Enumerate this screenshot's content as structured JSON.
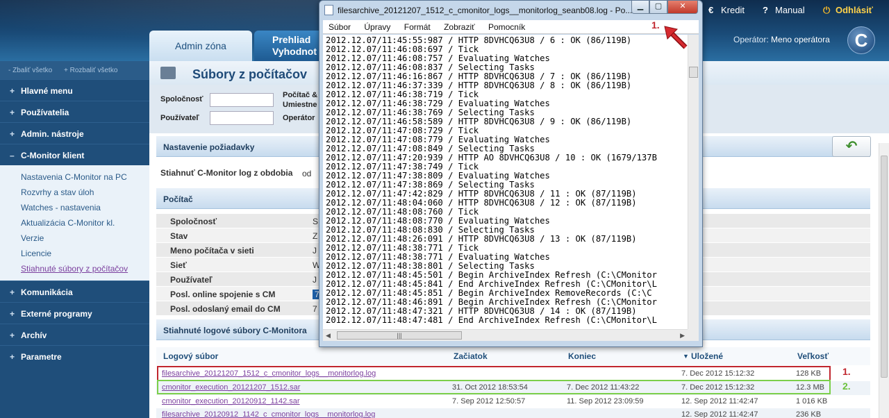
{
  "header": {
    "tabs": [
      {
        "label": "Admin zóna"
      },
      {
        "line1": "Prehliad",
        "line2": "Vyhodnot"
      }
    ],
    "menu": {
      "kredit": "Kredit",
      "manual": "Manual",
      "odhlasit": "Odhlásiť"
    },
    "operator_label": "Operátor:",
    "operator_name": "Meno operátora",
    "logo_letter": "C"
  },
  "sidebar": {
    "collapse_all": "- Zbaliť všetko",
    "expand_all": "+ Rozbaliť všetko",
    "items": [
      {
        "sign": "+",
        "label": "Hlavné menu"
      },
      {
        "sign": "+",
        "label": "Používatelia"
      },
      {
        "sign": "+",
        "label": "Admin. nástroje"
      },
      {
        "sign": "–",
        "label": "C-Monitor klient"
      }
    ],
    "subitems": [
      "Nastavenia C-Monitor na PC",
      "Rozvrhy a stav úloh",
      "Watches - nastavenia",
      "Aktualizácia C-Monitor kl.",
      "Verzie",
      "Licencie",
      "Stiahnuté súbory z počítačov"
    ],
    "items_after": [
      {
        "sign": "+",
        "label": "Komunikácia"
      },
      {
        "sign": "+",
        "label": "Externé programy"
      },
      {
        "sign": "+",
        "label": "Archív"
      },
      {
        "sign": "+",
        "label": "Parametre"
      }
    ]
  },
  "main": {
    "title": "Súbory z počítačov",
    "filters": {
      "company_label": "Spoločnosť",
      "user_label": "Používateľ",
      "computer_label": "Počítač &",
      "location_label": "Umiestne",
      "operator_label": "Operátor"
    },
    "request_section": "Nastavenie požiadavky",
    "download_label": "Stiahnuť C-Monitor log z obdobia",
    "download_from": "od",
    "computer_section": "Počítač",
    "computer_rows": [
      {
        "label": "Spoločnosť",
        "value": "S"
      },
      {
        "label": "Stav",
        "value": "Z"
      },
      {
        "label": "Meno počítača v sieti",
        "value": "J"
      },
      {
        "label": "Sieť",
        "value": "W"
      },
      {
        "label": "Používateľ",
        "value": "J"
      },
      {
        "label": "Posl. online spojenie s CM",
        "value": "7"
      },
      {
        "label": "Posl. odoslaný email do CM",
        "value": "7"
      }
    ],
    "logs_section": "Stiahnuté logové súbory C-Monitora",
    "table": {
      "headers": {
        "file": "Logový súbor",
        "start": "Začiatok",
        "end": "Koniec",
        "saved": "Uložené",
        "size": "Veľkosť"
      },
      "rows": [
        {
          "file": "filesarchive_20121207_1512_c_cmonitor_logs__monitorlog.log",
          "start": "",
          "end": "",
          "saved": "7. Dec 2012 15:12:32",
          "size": "128 KB"
        },
        {
          "file": "cmonitor_execution_20121207_1512.sar",
          "start": "31. Oct 2012 18:53:54",
          "end": "7. Dec 2012 11:43:22",
          "saved": "7. Dec 2012 15:12:32",
          "size": "12.3 MB"
        },
        {
          "file": "cmonitor_execution_20120912_1142.sar",
          "start": "7. Sep 2012 12:50:57",
          "end": "11. Sep 2012 23:09:59",
          "saved": "12. Sep 2012 11:42:47",
          "size": "1 016 KB"
        },
        {
          "file": "filesarchive_20120912_1142_c_cmonitor_logs__monitorlog.log",
          "start": "",
          "end": "",
          "saved": "12. Sep 2012 11:42:47",
          "size": "236 KB"
        }
      ]
    },
    "annotations": {
      "one": "1.",
      "two": "2."
    }
  },
  "notepad": {
    "title": "filesarchive_20121207_1512_c_cmonitor_logs__monitorlog_seanb08.log - Po...",
    "menu": [
      "Súbor",
      "Úpravy",
      "Formát",
      "Zobraziť",
      "Pomocník"
    ],
    "annotation": "1.",
    "lines": [
      "2012.12.07/11:45:55:987 / HTTP 8DVHCQ63U8 / 6 : OK (86/119B)",
      "2012.12.07/11:46:08:697 / Tick",
      "2012.12.07/11:46:08:757 / Evaluating Watches",
      "2012.12.07/11:46:08:837 / Selecting Tasks",
      "2012.12.07/11:46:16:867 / HTTP 8DVHCQ63U8 / 7 : OK (86/119B)",
      "2012.12.07/11:46:37:339 / HTTP 8DVHCQ63U8 / 8 : OK (86/119B)",
      "2012.12.07/11:46:38:719 / Tick",
      "2012.12.07/11:46:38:729 / Evaluating Watches",
      "2012.12.07/11:46:38:769 / Selecting Tasks",
      "2012.12.07/11:46:58:589 / HTTP 8DVHCQ63U8 / 9 : OK (86/119B)",
      "2012.12.07/11:47:08:729 / Tick",
      "2012.12.07/11:47:08:779 / Evaluating Watches",
      "2012.12.07/11:47:08:849 / Selecting Tasks",
      "2012.12.07/11:47:20:939 / HTTP AO 8DVHCQ63U8 / 10 : OK (1679/137B",
      "2012.12.07/11:47:38:749 / Tick",
      "2012.12.07/11:47:38:809 / Evaluating Watches",
      "2012.12.07/11:47:38:869 / Selecting Tasks",
      "2012.12.07/11:47:42:829 / HTTP 8DVHCQ63U8 / 11 : OK (87/119B)",
      "2012.12.07/11:48:04:060 / HTTP 8DVHCQ63U8 / 12 : OK (87/119B)",
      "2012.12.07/11:48:08:760 / Tick",
      "2012.12.07/11:48:08:770 / Evaluating Watches",
      "2012.12.07/11:48:08:830 / Selecting Tasks",
      "2012.12.07/11:48:26:091 / HTTP 8DVHCQ63U8 / 13 : OK (87/119B)",
      "2012.12.07/11:48:38:771 / Tick",
      "2012.12.07/11:48:38:771 / Evaluating Watches",
      "2012.12.07/11:48:38:801 / Selecting Tasks",
      "2012.12.07/11:48:45:501 / Begin ArchiveIndex Refresh (C:\\CMonitor",
      "2012.12.07/11:48:45:841 / End ArchiveIndex Refresh (C:\\CMonitor\\L",
      "2012.12.07/11:48:45:851 / Begin ArchiveIndex RemoveRecords (C:\\C",
      "2012.12.07/11:48:46:891 / Begin ArchiveIndex Refresh (C:\\CMonitor",
      "2012.12.07/11:48:47:321 / HTTP 8DVHCQ63U8 / 14 : OK (87/119B)",
      "2012.12.07/11:48:47:481 / End ArchiveIndex Refresh (C:\\CMonitor\\L"
    ]
  },
  "icons": {
    "kredit": "euro-icon",
    "manual": "question-icon",
    "odhlasit": "power-icon",
    "back": "back-arrow-icon"
  }
}
